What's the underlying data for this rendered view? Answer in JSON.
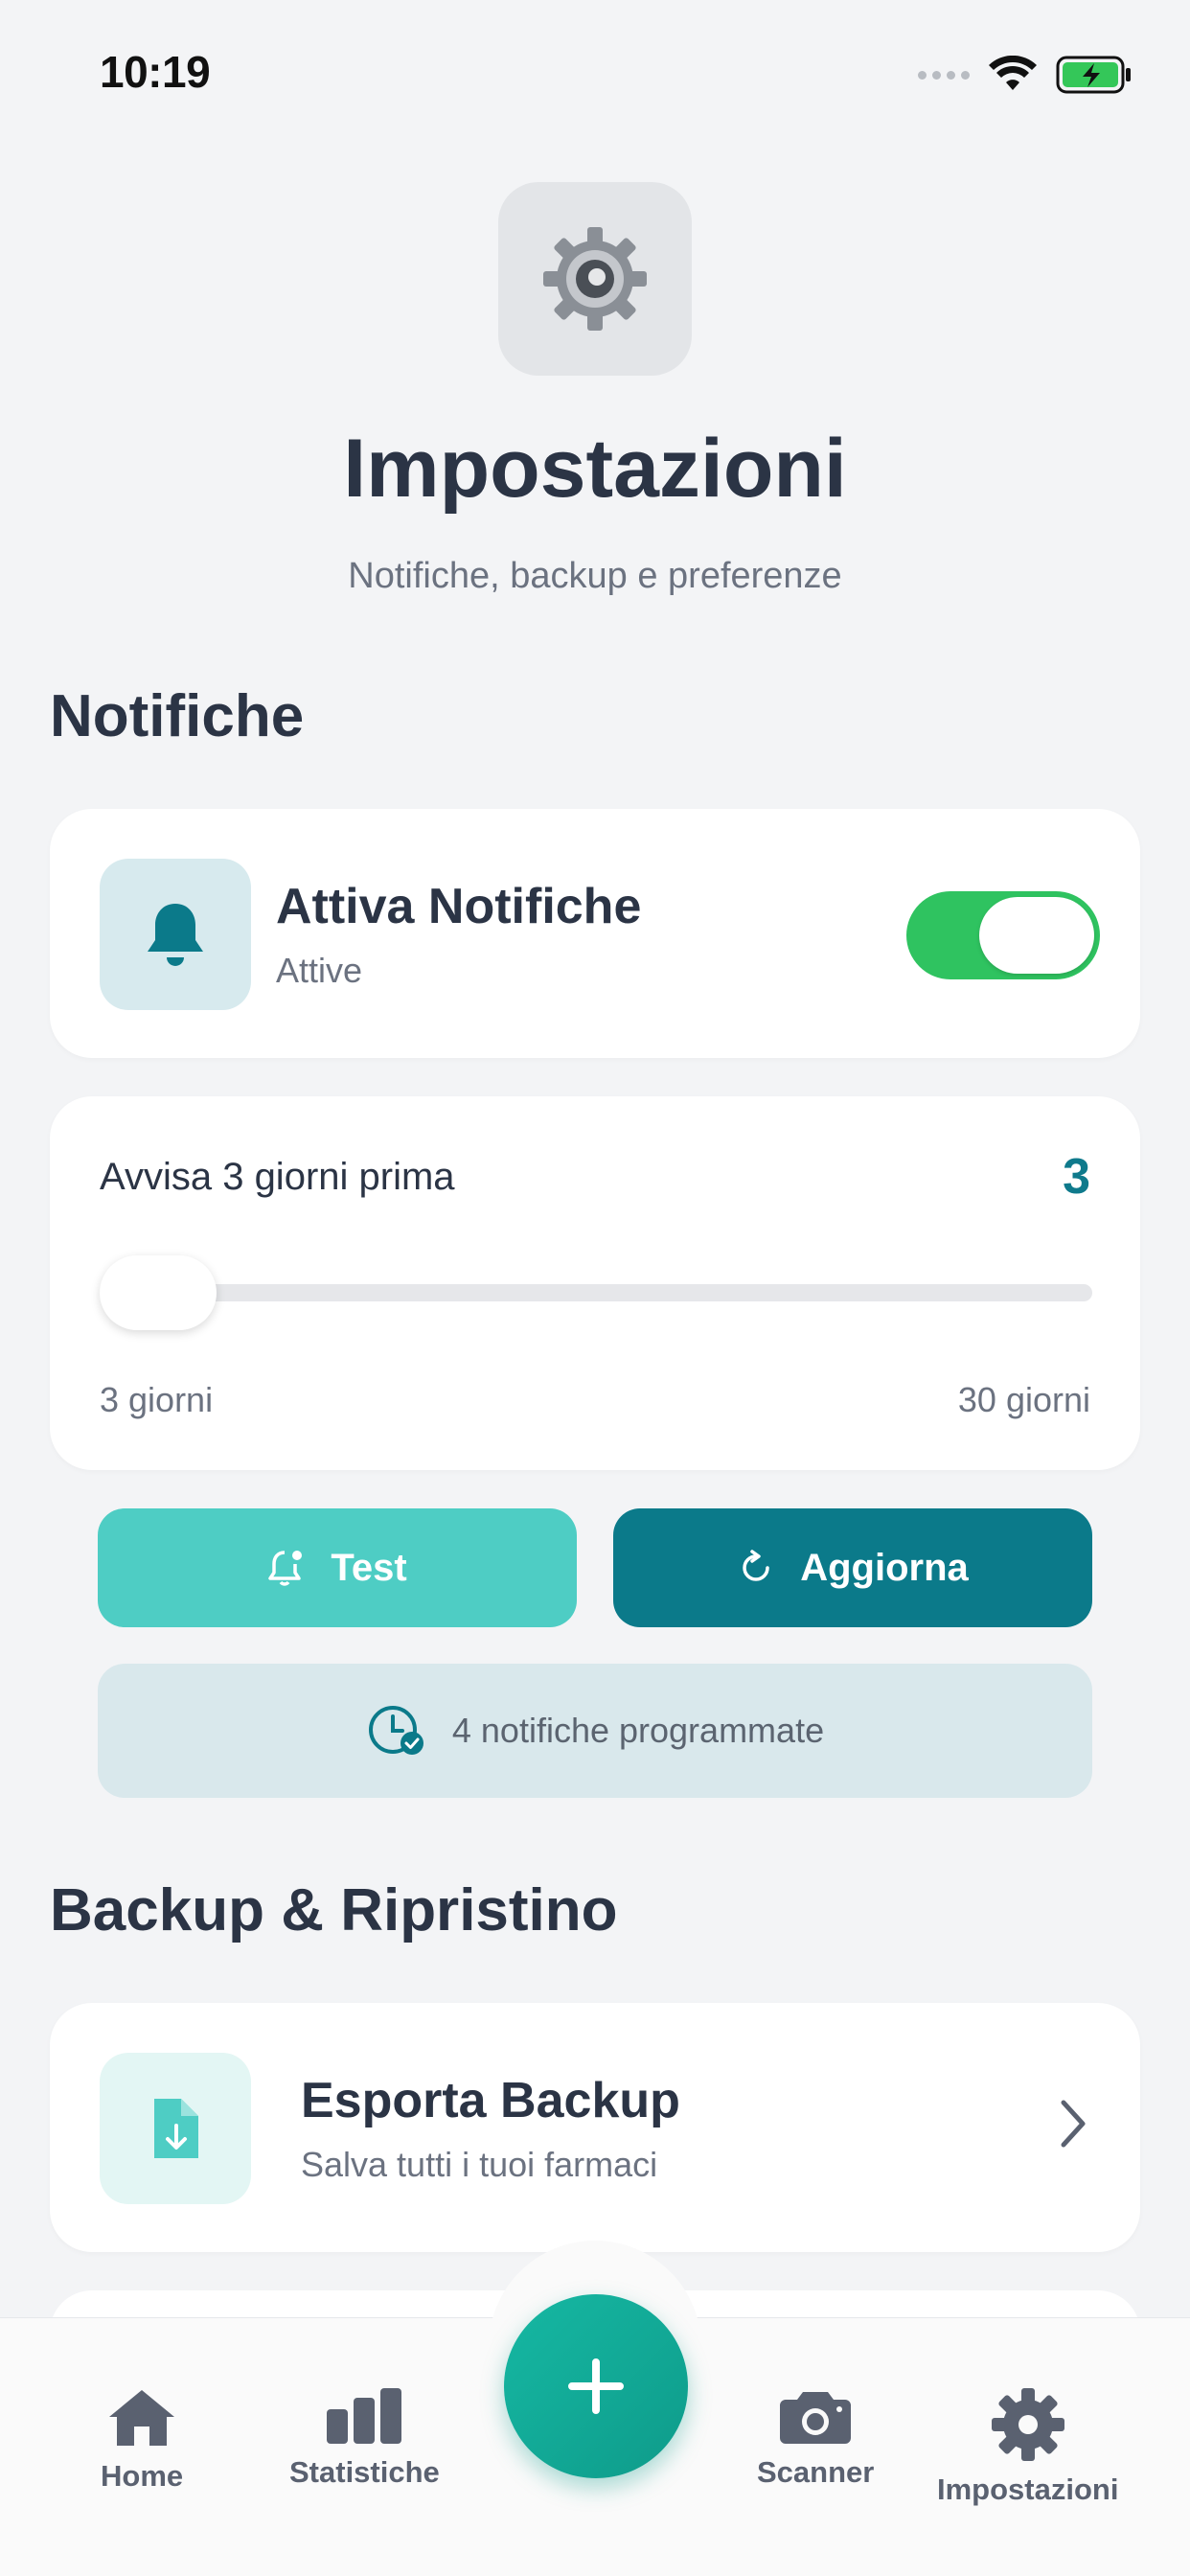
{
  "status_bar": {
    "time": "10:19"
  },
  "header": {
    "title": "Impostazioni",
    "subtitle": "Notifiche, backup e preferenze",
    "icon": "gear-icon"
  },
  "notifications": {
    "section_title": "Notifiche",
    "enable": {
      "title": "Attiva Notifiche",
      "status": "Attive",
      "enabled": true,
      "icon": "bell-icon"
    },
    "reminder": {
      "label": "Avvisa 3 giorni prima",
      "value": "3",
      "min_label": "3 giorni",
      "max_label": "30 giorni",
      "min": 3,
      "max": 30,
      "current": 3
    },
    "test_button": "Test",
    "refresh_button": "Aggiorna",
    "scheduled_text": "4 notifiche programmate"
  },
  "backup": {
    "section_title": "Backup & Ripristino",
    "export": {
      "title": "Esporta Backup",
      "subtitle": "Salva tutti i tuoi farmaci",
      "icon": "file-download-icon"
    }
  },
  "bottom_nav": {
    "items": [
      {
        "label": "Home",
        "icon": "home-icon"
      },
      {
        "label": "Statistiche",
        "icon": "bar-chart-icon"
      },
      {
        "label": "Scanner",
        "icon": "camera-icon"
      },
      {
        "label": "Impostazioni",
        "icon": "gear-icon"
      }
    ],
    "fab_icon": "plus-icon"
  },
  "colors": {
    "accent": "#0b7a8a",
    "teal_light": "#4ecdc4",
    "toggle_on": "#2fc360",
    "title_text": "#2b3445"
  }
}
